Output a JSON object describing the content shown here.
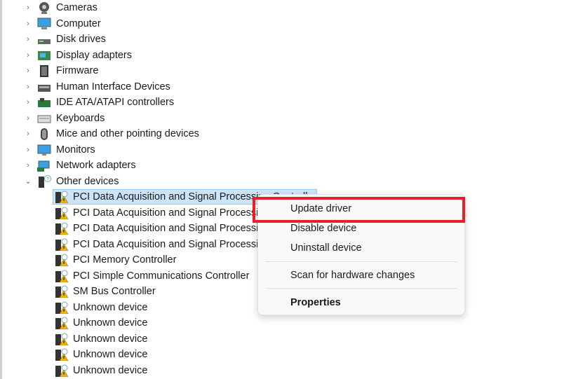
{
  "categories": [
    {
      "label": "Cameras",
      "icon": "camera-icon",
      "expanded": false
    },
    {
      "label": "Computer",
      "icon": "computer-icon",
      "expanded": false
    },
    {
      "label": "Disk drives",
      "icon": "disk-drive-icon",
      "expanded": false
    },
    {
      "label": "Display adapters",
      "icon": "display-adapter-icon",
      "expanded": false
    },
    {
      "label": "Firmware",
      "icon": "firmware-icon",
      "expanded": false
    },
    {
      "label": "Human Interface Devices",
      "icon": "hid-icon",
      "expanded": false
    },
    {
      "label": "IDE ATA/ATAPI controllers",
      "icon": "ide-controller-icon",
      "expanded": false
    },
    {
      "label": "Keyboards",
      "icon": "keyboard-icon",
      "expanded": false
    },
    {
      "label": "Mice and other pointing devices",
      "icon": "mouse-icon",
      "expanded": false
    },
    {
      "label": "Monitors",
      "icon": "monitor-icon",
      "expanded": false
    },
    {
      "label": "Network adapters",
      "icon": "network-adapter-icon",
      "expanded": false
    },
    {
      "label": "Other devices",
      "icon": "other-devices-icon",
      "expanded": true
    }
  ],
  "other_devices": [
    "PCI Data Acquisition and Signal Processing Controller",
    "PCI Data Acquisition and Signal Processing Controller",
    "PCI Data Acquisition and Signal Processing Controller",
    "PCI Data Acquisition and Signal Processing Controller",
    "PCI Memory Controller",
    "PCI Simple Communications Controller",
    "SM Bus Controller",
    "Unknown device",
    "Unknown device",
    "Unknown device",
    "Unknown device",
    "Unknown device"
  ],
  "context_menu": {
    "update_driver": "Update driver",
    "disable_device": "Disable device",
    "uninstall_device": "Uninstall device",
    "scan": "Scan for hardware changes",
    "properties": "Properties"
  },
  "colors": {
    "highlight": "#e3202c",
    "selection": "#cce4f7",
    "warning": "#f2b705"
  }
}
